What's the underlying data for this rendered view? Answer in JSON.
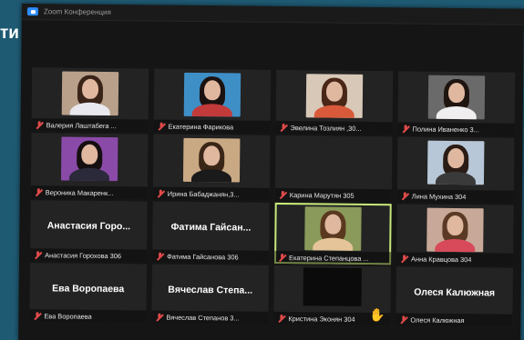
{
  "background_text": "ти",
  "window": {
    "title": "Zoom Конференция"
  },
  "participants": [
    {
      "name": "Валерия Лаштабега ...",
      "video": true,
      "bg": "#b9a08a",
      "hair": "#3a2418",
      "shirt": "#e8e8ee"
    },
    {
      "name": "Екатерина Фарикова",
      "video": true,
      "bg": "#3f8fc7",
      "hair": "#1b1210",
      "shirt": "#c23a3a"
    },
    {
      "name": "Эвелина Тозлиян ,30...",
      "video": true,
      "bg": "#d8c8b8",
      "hair": "#4a2616",
      "shirt": "#d85a3a"
    },
    {
      "name": "Полина Иваненко 3...",
      "video": true,
      "bg": "#6a6a6a",
      "hair": "#1e1410",
      "shirt": "#f0eeee"
    },
    {
      "name": "Вероника Макаренк...",
      "video": true,
      "bg": "#8a4aa8",
      "hair": "#150f10",
      "shirt": "#2a2a3a"
    },
    {
      "name": "Ирина Бабаджанян,3...",
      "video": true,
      "bg": "#c9a983",
      "hair": "#3a2616",
      "shirt": "#1a1a1a"
    },
    {
      "name": "Карина Марутян 305",
      "video": false,
      "display_name": ""
    },
    {
      "name": "Лина Мухина 304",
      "video": true,
      "bg": "#b7c7d7",
      "hair": "#2a1c14",
      "shirt": "#3a3a3a"
    },
    {
      "name": "Анастасия Горохова 306",
      "video": false,
      "display_name": "Анастасия Горо..."
    },
    {
      "name": "Фатима Гайсанова 306",
      "video": false,
      "display_name": "Фатима Гайсан..."
    },
    {
      "name": "Екатерина Степанцова ...",
      "video": true,
      "bg": "#8a9a5a",
      "hair": "#5a3820",
      "shirt": "#e6c49a",
      "active": true
    },
    {
      "name": "Анна Кравцова 304",
      "video": true,
      "bg": "#c8a898",
      "hair": "#5a3a24",
      "shirt": "#d84a5a"
    },
    {
      "name": "Ева Воропаева",
      "video": false,
      "display_name": "Ева Воропаева"
    },
    {
      "name": "Вячеслав Степанов 3...",
      "video": false,
      "display_name": "Вячеслав Степа..."
    },
    {
      "name": "Кристина Эконян 304",
      "video": "off",
      "hand_raised": true
    },
    {
      "name": "Олеся Калюжная",
      "video": false,
      "display_name": "Олеся Калюжная"
    }
  ]
}
